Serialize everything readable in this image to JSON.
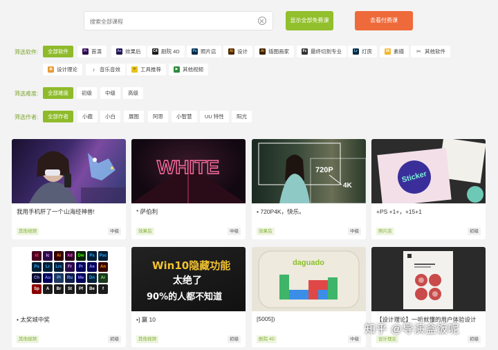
{
  "search": {
    "placeholder": "搜索全部课程"
  },
  "buttons": {
    "show_all": "显示全部免费课",
    "paid": "去看付费课"
  },
  "filters": {
    "software": {
      "label": "筛选软件:",
      "items": [
        {
          "label": "全部软件",
          "icon": "",
          "color": ""
        },
        {
          "label": "首演",
          "icon": "Pr",
          "color": "#2a0b4a"
        },
        {
          "label": "效果后",
          "icon": "Ae",
          "color": "#1d1547"
        },
        {
          "label": "剧院 4D",
          "icon": "C4",
          "color": "#1c1c1c"
        },
        {
          "label": "照片店",
          "icon": "Ps",
          "color": "#0b2a44"
        },
        {
          "label": "设计",
          "icon": "Ai",
          "color": "#4a2a00"
        },
        {
          "label": "插图画家",
          "icon": "Ai",
          "color": "#3a2000"
        },
        {
          "label": "最终切割专业",
          "icon": "Fc",
          "color": "#333"
        },
        {
          "label": "灯房",
          "icon": "Lr",
          "color": "#0d2a3f"
        },
        {
          "label": "素描",
          "icon": "Sk",
          "color": "#f2b72a"
        },
        {
          "label": "其他软件",
          "icon": "✂",
          "color": "#555"
        },
        {
          "label": "设计理论",
          "icon": "▣",
          "color": "#e89a35"
        },
        {
          "label": "音乐音效",
          "icon": "♪",
          "color": "#666"
        },
        {
          "label": "工具推荐",
          "icon": "✕",
          "color": "#e6c31e"
        },
        {
          "label": "其他视频",
          "icon": "▶",
          "color": "#2e8b3e"
        }
      ]
    },
    "difficulty": {
      "label": "筛选难度:",
      "items": [
        {
          "label": "全部难度"
        },
        {
          "label": "初级"
        },
        {
          "label": "中级"
        },
        {
          "label": "高级"
        }
      ]
    },
    "author": {
      "label": "筛选作者:",
      "items": [
        {
          "label": "全部作者"
        },
        {
          "label": "小鹿"
        },
        {
          "label": "小白"
        },
        {
          "label": "展图"
        },
        {
          "label": "阿思"
        },
        {
          "label": "小智慧"
        },
        {
          "label": "UU 特性"
        },
        {
          "label": "阳光"
        }
      ]
    }
  },
  "cards": [
    {
      "title": "我用手机肝了一个山海经神兽!",
      "category": "其他视频",
      "level": "中级"
    },
    {
      "title": "* 萨伯利",
      "category": "效果后",
      "level": "中级",
      "thumb_text": "WHITE"
    },
    {
      "title": "• 720P4K，快乐。",
      "category": "效果后",
      "level": "中级",
      "thumb_text_a": "720P",
      "thumb_text_b": "4K"
    },
    {
      "title": "+PS +1+，+15+1",
      "category": "照片店",
      "level": "初级",
      "thumb_text": "Sticker"
    },
    {
      "title": "• 太奖城中奖",
      "category": "其他视频",
      "level": "初级"
    },
    {
      "title": "•] 赢 10",
      "category": "其他视频",
      "level": "初级",
      "thumb_line1": "Win10隐藏功能",
      "thumb_line2": "太绝了",
      "thumb_line3": "90%的人都不知道"
    },
    {
      "title": "[5005])",
      "category": "剧院 4D",
      "level": "中级",
      "thumb_text": "daguado"
    },
    {
      "title": "【设计理论】一听就懂的用户体验设计",
      "category": "设计理论",
      "level": "初级"
    }
  ],
  "adobe_grid": [
    "Id",
    "Ic",
    "Ai",
    "Xd",
    "Dw",
    "Ps",
    "Psc",
    "Ps",
    "Lr",
    "Lrc",
    "Fr",
    "Pr",
    "Ae",
    "An",
    "Ch",
    "Au",
    "Pl",
    "Ru",
    "Me",
    "Dn",
    "Ar",
    "Sp",
    "A",
    "Br",
    "St",
    "Pf",
    "Be",
    "f"
  ],
  "watermark": "知乎 @导演盒饭呢"
}
